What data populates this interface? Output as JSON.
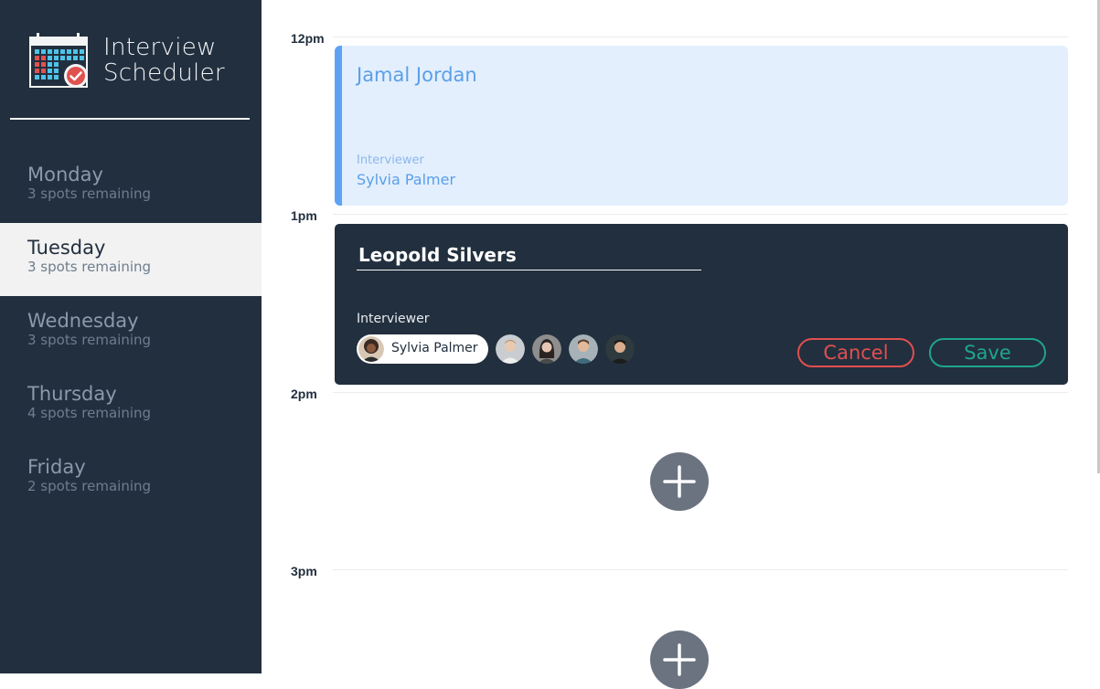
{
  "app": {
    "title_line1": "Interview",
    "title_line2": "Scheduler"
  },
  "sidebar": {
    "days": [
      {
        "name": "Monday",
        "spots": "3 spots remaining"
      },
      {
        "name": "Tuesday",
        "spots": "3 spots remaining",
        "selected": true
      },
      {
        "name": "Wednesday",
        "spots": "3 spots remaining"
      },
      {
        "name": "Thursday",
        "spots": "4 spots remaining"
      },
      {
        "name": "Friday",
        "spots": "2 spots remaining"
      }
    ]
  },
  "schedule": {
    "times": [
      "12pm",
      "1pm",
      "2pm",
      "3pm"
    ],
    "show": {
      "student": "Jamal Jordan",
      "interviewer_label": "Interviewer",
      "interviewer_name": "Sylvia Palmer"
    },
    "form": {
      "student_value": "Leopold Silvers",
      "interviewer_label": "Interviewer",
      "selected_interviewer": "Sylvia Palmer",
      "other_interviewers": [
        "interviewer-2-avatar",
        "interviewer-3-avatar",
        "interviewer-4-avatar",
        "interviewer-5-avatar"
      ],
      "cancel_label": "Cancel",
      "save_label": "Save"
    },
    "add_icon": "plus-icon"
  },
  "colors": {
    "sidebar_bg": "#222f3e",
    "show_bg": "#e3effd",
    "show_accent": "#5fa2f5",
    "cancel": "#e04f4f",
    "save": "#1fa58a",
    "add_button": "#6b7380"
  }
}
